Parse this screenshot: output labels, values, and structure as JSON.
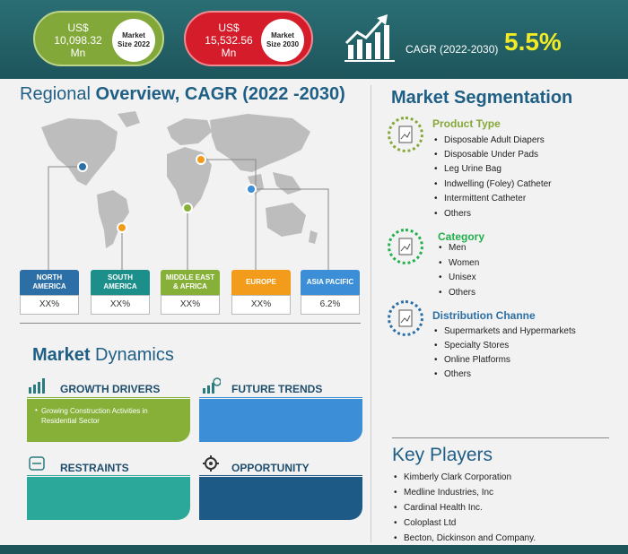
{
  "header": {
    "market2022": {
      "amount_line1": "US$",
      "amount_line2": "10,098.32",
      "amount_line3": "Mn",
      "label_line1": "Market",
      "label_line2": "Size 2022"
    },
    "market2030": {
      "amount_line1": "US$",
      "amount_line2": "15,532.56",
      "amount_line3": "Mn",
      "label_line1": "Market",
      "label_line2": "Size 2030"
    },
    "cagr_label": "CAGR (2022-2030)",
    "cagr_value": "5.5%"
  },
  "regional": {
    "title_part1": "Regional ",
    "title_part2": "Overview, CAGR (2022 -2030)",
    "regions": [
      {
        "name_line1": "NORTH",
        "name_line2": "AMERICA",
        "value": "XX%",
        "color": "#2b6fa6"
      },
      {
        "name_line1": "SOUTH",
        "name_line2": "AMERICA",
        "value": "XX%",
        "color": "#1c8f8a"
      },
      {
        "name_line1": "MIDDLE EAST",
        "name_line2": "& AFRICA",
        "value": "XX%",
        "color": "#86b038"
      },
      {
        "name_line1": "EUROPE",
        "name_line2": "",
        "value": "XX%",
        "color": "#f39c1c"
      },
      {
        "name_line1": "ASIA PACIFIC",
        "name_line2": "",
        "value": "6.2%",
        "color": "#3c8fd6"
      }
    ]
  },
  "dynamics": {
    "title_part1": "Market ",
    "title_part2": "Dynamics",
    "growth_drivers": {
      "label": "GROWTH DRIVERS",
      "items": [
        "Growing Construction Activities in Residential Sector"
      ]
    },
    "future_trends": {
      "label": "FUTURE TRENDS"
    },
    "restraints": {
      "label": "RESTRAINTS"
    },
    "opportunity": {
      "label": "OPPORTUNITY"
    }
  },
  "segmentation": {
    "title": "Market Segmentation",
    "groups": [
      {
        "label": "Product Type",
        "color": "#86a83a",
        "items": [
          "Disposable Adult Diapers",
          "Disposable Under Pads",
          "Leg Urine Bag",
          "Indwelling (Foley) Catheter",
          "Intermittent Catheter",
          "Others"
        ]
      },
      {
        "label": "Category",
        "color": "#22b04b",
        "items": [
          "Men",
          "Women",
          "Unisex",
          "Others"
        ]
      },
      {
        "label": "Distribution Channe",
        "color": "#2b6fa6",
        "items": [
          "Supermarkets and Hypermarkets",
          "Specialty Stores",
          "Online Platforms",
          "Others"
        ]
      }
    ]
  },
  "key_players": {
    "title": "Key Players",
    "items": [
      "Kimberly Clark Corporation",
      "Medline Industries, Inc",
      "Cardinal Health Inc.",
      "Coloplast Ltd",
      "Becton, Dickinson and Company."
    ]
  }
}
